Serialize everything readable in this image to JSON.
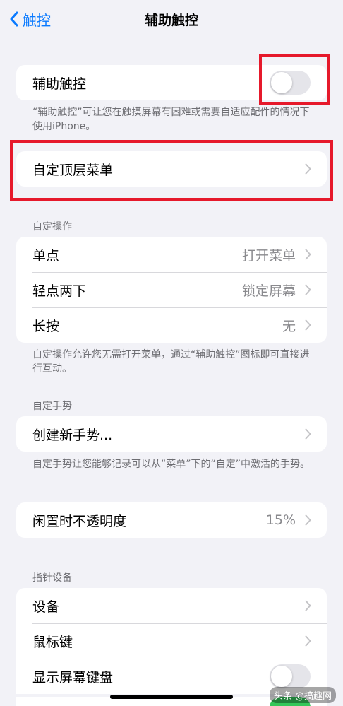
{
  "nav": {
    "back_label": "触控",
    "title": "辅助触控"
  },
  "assistive": {
    "label": "辅助触控",
    "enabled": false,
    "footer": "“辅助触控”可让您在触摸屏幕有困难或需要自适应配件的情况下使用iPhone。"
  },
  "top_menu": {
    "label": "自定顶层菜单"
  },
  "custom_actions": {
    "header": "自定操作",
    "rows": [
      {
        "label": "单点",
        "value": "打开菜单"
      },
      {
        "label": "轻点两下",
        "value": "锁定屏幕"
      },
      {
        "label": "长按",
        "value": "无"
      }
    ],
    "footer": "自定操作允许您无需打开菜单，通过“辅助触控”图标即可直接进行互动。"
  },
  "custom_gestures": {
    "header": "自定手势",
    "create_label": "创建新手势...",
    "footer": "自定手势让您能够记录可以从“菜单”下的“自定”中激活的手势。"
  },
  "idle_opacity": {
    "label": "闲置时不透明度",
    "value": "15%"
  },
  "pointer_devices": {
    "header": "指针设备",
    "rows": [
      {
        "label": "设备"
      },
      {
        "label": "鼠标键"
      },
      {
        "label": "显示屏幕键盘",
        "enabled": false
      }
    ]
  },
  "watermark": "头条 @搞趣网",
  "colors": {
    "accent": "#0a7aff",
    "highlight": "#e6192b",
    "toggle_on": "#34c759"
  }
}
